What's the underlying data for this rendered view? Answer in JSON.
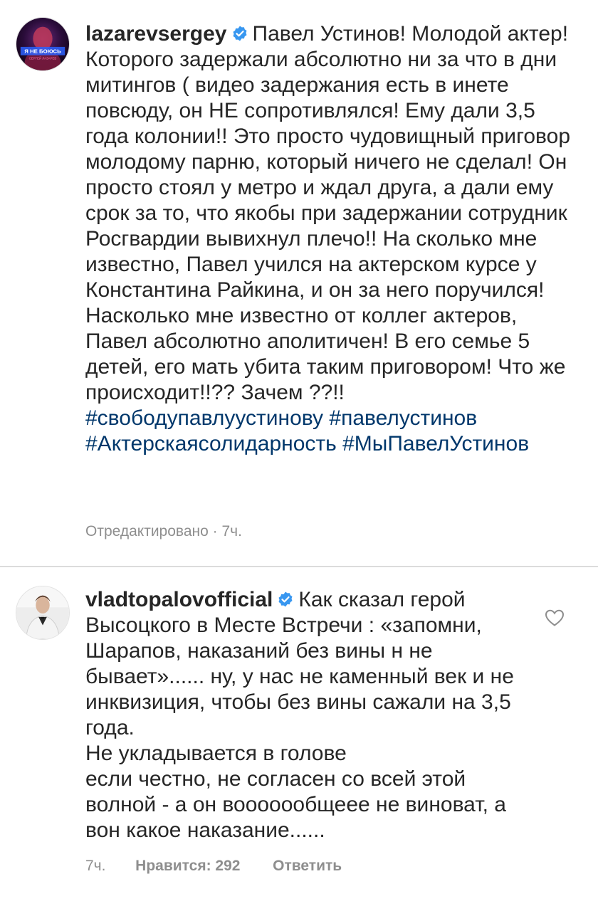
{
  "post": {
    "username": "lazarevsergey",
    "avatar_text": "Я НЕ БОЮСЬ",
    "avatar_subtext": "СЕРГЕЙ ЛАЗАРЕВ",
    "caption": "Павел Устинов! Молодой актер! Которого задержали абсолютно ни за что в дни митингов ( видео задержания есть в инете повсюду, он НЕ сопротивлялся! Ему дали 3,5 года колонии!! Это просто чудовищный приговор  молодому парню, который ничего не сделал! Он просто стоял у метро и ждал друга, а дали ему срок за то, что якобы при задержании сотрудник Росгвардии вывихнул плечо!! На сколько мне известно, Павел учился на актерском курсе у Константина Райкина, и он за него поручился! Насколько мне известно от коллег актеров, Павел абсолютно аполитичен! В его семье 5 детей, его мать убита таким приговором! Что же происходит!!?? Зачем ??!!",
    "hashtags": [
      "#свободупавлуустинову",
      "#павелустинов",
      "#Актерскаясолидарность",
      "#МыПавелУстинов"
    ],
    "edited_label": "Отредактировано",
    "separator": "·",
    "time": "7ч."
  },
  "comment": {
    "username": "vladtopalovofficial",
    "paragraphs": [
      "Как сказал герой Высоцкого в Месте Встречи : «запомни, Шарапов, наказаний без вины н не бывает»...... ну, у нас не каменный век и не инквизиция, чтобы без вины сажали на 3,5 года.",
      "Не укладывается в голове",
      "если честно, не согласен со всей этой волной - а он вооооообщеее не виноват, а вон какое наказание......"
    ],
    "time": "7ч.",
    "likes_label": "Нравится: 292",
    "reply_label": "Ответить"
  },
  "colors": {
    "text": "#262626",
    "hashtag": "#00376b",
    "meta": "#8e8e8e",
    "verified": "#3897f0",
    "divider": "#dbdbdb"
  },
  "icons": {
    "verified": "verified-badge-icon",
    "heart": "heart-outline-icon"
  }
}
